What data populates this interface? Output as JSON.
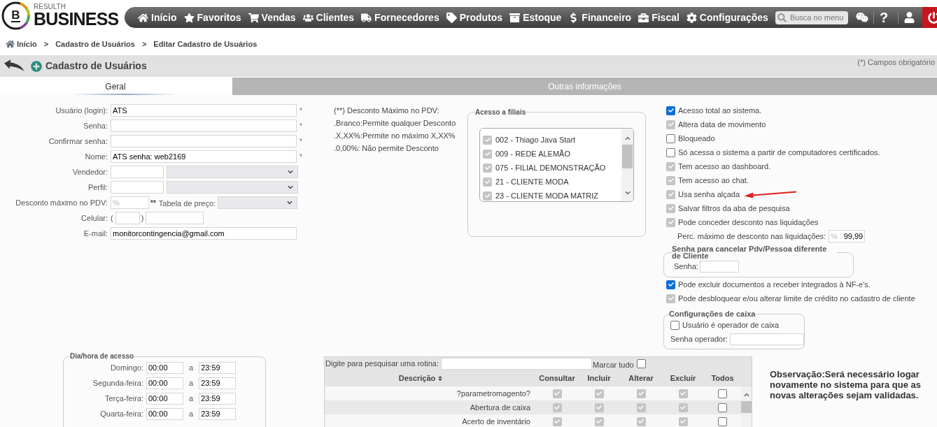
{
  "header": {
    "logo": {
      "letter": "B",
      "tagline": "RESULTH",
      "name": "BUSINESS"
    },
    "nav": [
      {
        "label": "Início"
      },
      {
        "label": "Favoritos"
      },
      {
        "label": "Vendas"
      },
      {
        "label": "Clientes"
      },
      {
        "label": "Fornecedores"
      },
      {
        "label": "Produtos"
      },
      {
        "label": "Estoque"
      },
      {
        "label": "Financeiro"
      },
      {
        "label": "Fiscal"
      },
      {
        "label": "Configurações"
      }
    ],
    "search": {
      "placeholder": "Busca no menu"
    },
    "help": "?"
  },
  "breadcrumb": [
    {
      "label": "Início"
    },
    {
      "separator": ">",
      "label": "Cadastro de Usuários"
    },
    {
      "separator": ">",
      "label": "Editar Cadastro de Usuários"
    }
  ],
  "page": {
    "title": "Cadastro de Usuários",
    "required_note": "(*) Campos obrigatório"
  },
  "tabs": [
    {
      "label": "Geral",
      "selected": true
    },
    {
      "label": "Outras informações",
      "selected": false
    }
  ],
  "user_form": [
    {
      "kind": "text",
      "label": "Usuário (login):",
      "value": "ATS",
      "required": "*"
    },
    {
      "kind": "text",
      "label": "Senha:",
      "required": "*"
    },
    {
      "kind": "text",
      "label": "Confirmar senha:",
      "required": "*"
    },
    {
      "kind": "text",
      "label": "Nome:",
      "value": "ATS senha: web2169",
      "required": "*"
    },
    {
      "kind": "code_select",
      "label": "Vendedor:",
      "select_disabled": true
    },
    {
      "kind": "code_select",
      "label": "Perfil:",
      "select_disabled": true
    },
    {
      "kind": "discount",
      "label": "Desconto máximo no PDV:",
      "placeholder": "%",
      "note": "**",
      "price_table": {
        "label": "Tabela de preço:",
        "disabled": true
      }
    },
    {
      "kind": "phone",
      "label": "Celular:",
      "open": "(",
      "close": ")"
    },
    {
      "kind": "text",
      "label": "E-mail:",
      "value": "monitorcontingencia@gmail.com"
    }
  ],
  "discount_help": [
    "(**) Desconto Máximo no PDV:",
    ".Branco:Permite qualquer Desconto",
    ".X,XX%:Permite no máximo X,XX%",
    ".0,00%: Não permite Desconto"
  ],
  "branch_access": {
    "legend": "Acesso a filiais",
    "branches": [
      {
        "label": "002 - Thiago Java Start",
        "checked": true,
        "disabled": true
      },
      {
        "label": "009 - REDE ALEMÃO",
        "checked": true,
        "disabled": true
      },
      {
        "label": "075 - FILIAL DEMONSTRAÇÃO",
        "checked": true,
        "disabled": true
      },
      {
        "label": "21 - CLIENTE MODA",
        "checked": true,
        "disabled": true
      },
      {
        "label": "23 - CLIENTE MODA MATRIZ",
        "checked": true,
        "disabled": true
      }
    ]
  },
  "permissions": [
    {
      "kind": "checkbox",
      "label": "Acesso total ao sistema.",
      "checked": true,
      "disabled": false
    },
    {
      "kind": "checkbox",
      "label": "Altera data de movimento",
      "checked": true,
      "disabled": true
    },
    {
      "kind": "checkbox",
      "label": "Bloqueado",
      "checked": false,
      "disabled": false
    },
    {
      "kind": "checkbox",
      "label": "Só acessa o sistema a partir de computadores certificados.",
      "checked": false,
      "disabled": false
    },
    {
      "kind": "checkbox",
      "label": "Tem acesso ao dashboard.",
      "checked": true,
      "disabled": true
    },
    {
      "kind": "checkbox",
      "label": "Tem acesso ao chat.",
      "checked": true,
      "disabled": true
    },
    {
      "kind": "checkbox",
      "label": "Usa senha alçada",
      "checked": true,
      "disabled": true,
      "pointer": true
    },
    {
      "kind": "checkbox",
      "label": "Salvar filtros da aba de pesquisa",
      "checked": true,
      "disabled": true
    },
    {
      "kind": "checkbox",
      "label": "Pode conceder desconto nas liquidações",
      "checked": true,
      "disabled": true
    },
    {
      "kind": "percent",
      "label": "Perc. máximo de desconto nas liquidações:",
      "placeholder": "%",
      "value": "99,99"
    },
    {
      "kind": "password_group",
      "legend": "Senha para cancelar Pdv/Pessoa diferente de Cliente",
      "field_label": "Senha:"
    },
    {
      "kind": "checkbox",
      "label": "Pode excluir documentos a receber integrados à NF-e's.",
      "checked": true,
      "disabled": false
    },
    {
      "kind": "checkbox",
      "label": "Pode desbloquear e/ou alterar limite de crédito no cadastro de cliente",
      "checked": true,
      "disabled": true
    },
    {
      "kind": "cashier_group",
      "legend": "Configurações de caixa",
      "checkbox": {
        "label": "Usuário é operador de caixa",
        "checked": false,
        "disabled": false
      },
      "field_label": "Senha operador:"
    }
  ],
  "access_hours": {
    "legend": "Dia/hora de acesso",
    "days": [
      {
        "label": "Domingo:",
        "from": "00:00",
        "separator": "a",
        "to": "23:59"
      },
      {
        "label": "Segunda-feira:",
        "from": "00:00",
        "separator": "a",
        "to": "23:59"
      },
      {
        "label": "Terça-feira:",
        "from": "00:00",
        "separator": "a",
        "to": "23:59"
      },
      {
        "label": "Quarta-feira:",
        "from": "00:00",
        "separator": "a",
        "to": "23:59"
      }
    ]
  },
  "routines": {
    "search_label": "Digite para pesquisar uma rotina:",
    "mark_all": {
      "label": "Marcar tudo",
      "checked": false
    },
    "columns": [
      {
        "label": "Descrição",
        "sort": true
      },
      {
        "label": "Consultar"
      },
      {
        "label": "Incluir"
      },
      {
        "label": "Alterar"
      },
      {
        "label": "Excluir"
      },
      {
        "label": "Todos"
      }
    ],
    "rows": [
      {
        "label": "?parametromagento?",
        "checks": [
          {
            "checked": true,
            "disabled": true
          },
          {
            "checked": true,
            "disabled": true
          },
          {
            "checked": true,
            "disabled": true
          },
          {
            "checked": true,
            "disabled": true
          },
          {
            "checked": false,
            "disabled": false
          }
        ]
      },
      {
        "label": "Abertura de caixa",
        "checks": [
          {
            "checked": true,
            "disabled": true
          },
          {
            "checked": true,
            "disabled": true
          },
          {
            "checked": true,
            "disabled": true
          },
          {
            "checked": true,
            "disabled": true
          },
          {
            "checked": false,
            "disabled": false
          }
        ]
      },
      {
        "label": "Acerto de inventário",
        "checks": [
          {
            "checked": true,
            "disabled": true
          },
          {
            "checked": true,
            "disabled": true
          },
          {
            "checked": true,
            "disabled": true
          },
          {
            "checked": true,
            "disabled": true
          },
          {
            "checked": false,
            "disabled": false
          }
        ]
      }
    ]
  },
  "note": "Observação:Será necessário logar novamente no sistema para que as novas alterações sejam validadas."
}
